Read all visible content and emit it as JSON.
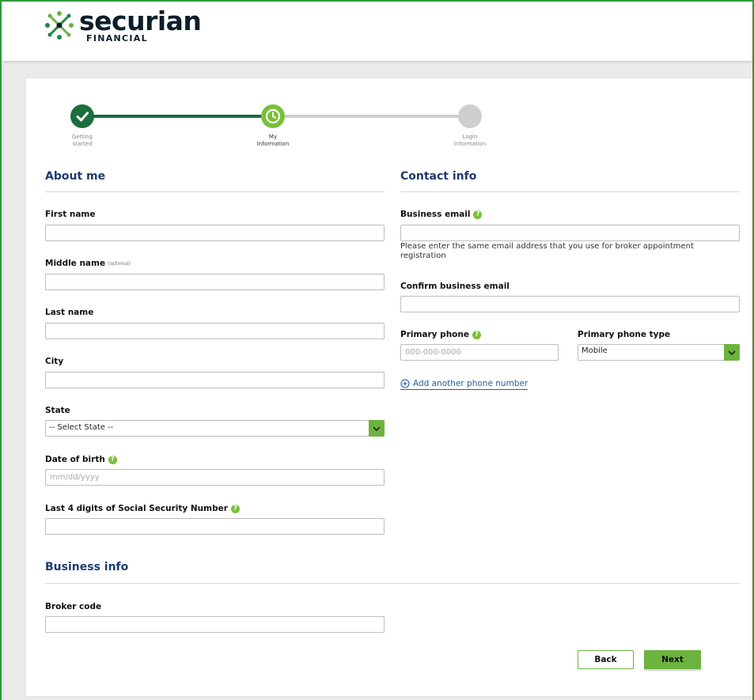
{
  "brand": {
    "name": "securian",
    "subtitle": "FINANCIAL"
  },
  "progress": {
    "steps": [
      {
        "label_line1": "Getting",
        "label_line2": "started",
        "status": "complete"
      },
      {
        "label_line1": "My",
        "label_line2": "Information",
        "status": "current"
      },
      {
        "label_line1": "Login",
        "label_line2": "Information",
        "status": "upcoming"
      }
    ]
  },
  "about_me": {
    "title": "About me",
    "first_name": {
      "label": "First name",
      "value": ""
    },
    "middle_name": {
      "label": "Middle name",
      "optional": "(optional)",
      "value": ""
    },
    "last_name": {
      "label": "Last name",
      "value": ""
    },
    "city": {
      "label": "City",
      "value": ""
    },
    "state": {
      "label": "State",
      "selected": "-- Select State --"
    },
    "dob": {
      "label": "Date of birth",
      "placeholder": "mm/dd/yyyy"
    },
    "ssn4": {
      "label": "Last 4 digits of Social Security Number",
      "value": ""
    }
  },
  "contact_info": {
    "title": "Contact info",
    "business_email": {
      "label": "Business email",
      "value": "",
      "hint": "Please enter the same email address that you use for broker appointment registration"
    },
    "confirm_email": {
      "label": "Confirm business email",
      "value": ""
    },
    "primary_phone": {
      "label": "Primary phone",
      "placeholder": "000-000-0000"
    },
    "phone_type": {
      "label": "Primary phone type",
      "selected": "Mobile"
    },
    "add_phone": "Add another phone number"
  },
  "business_info": {
    "title": "Business info",
    "broker_code": {
      "label": "Broker code",
      "value": ""
    }
  },
  "actions": {
    "back": "Back",
    "next": "Next"
  },
  "colors": {
    "brand_green": "#6db33f",
    "dark_green": "#1f7a3f",
    "heading_blue": "#1f3b6f",
    "link_blue": "#1f5fa6"
  }
}
